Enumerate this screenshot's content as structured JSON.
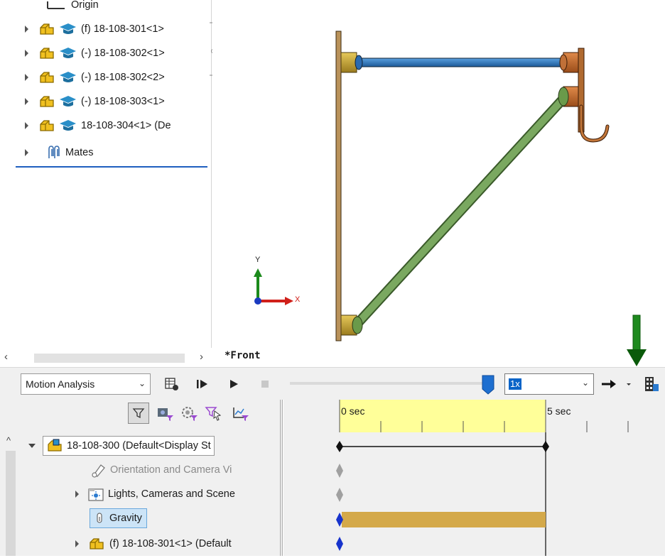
{
  "feature_tree": {
    "items": [
      {
        "label": "Origin",
        "icon": "origin-icon"
      },
      {
        "label": "(f) 18-108-301<1>",
        "icon": "part-icon"
      },
      {
        "label": "(-) 18-108-302<1>",
        "icon": "part-icon"
      },
      {
        "label": "(-) 18-108-302<2>",
        "icon": "part-icon"
      },
      {
        "label": "(-) 18-108-303<1>",
        "icon": "part-icon"
      },
      {
        "label": "18-108-304<1> (De",
        "icon": "part-icon"
      },
      {
        "label": "Mates",
        "icon": "mates-icon"
      }
    ]
  },
  "viewport": {
    "view_name": "*Front",
    "triad": {
      "y_label": "Y",
      "x_label": "X"
    }
  },
  "motion_toolbar": {
    "study_type": "Motion Analysis",
    "speed": "1x",
    "colors": {
      "indicator_arrow": "#1e8a1e",
      "slider_handle": "#1e6fd0"
    }
  },
  "timeline": {
    "ticks": [
      "0 sec",
      "5 sec"
    ],
    "colors": {
      "highlight": "#ffff99",
      "gravity_bar": "#d4a94a",
      "key_blue": "#1733cc",
      "key_grey": "#a0a0a0"
    }
  },
  "motion_tree": {
    "items": [
      {
        "label": "18-108-300  (Default<Display St",
        "icon": "assembly-icon"
      },
      {
        "label": "Orientation and Camera Vi",
        "icon": "camera-icon"
      },
      {
        "label": "Lights, Cameras and Scene",
        "icon": "lights-icon"
      },
      {
        "label": "Gravity",
        "icon": "gravity-icon"
      },
      {
        "label": "(f) 18-108-301<1> (Default",
        "icon": "part-icon"
      }
    ]
  }
}
